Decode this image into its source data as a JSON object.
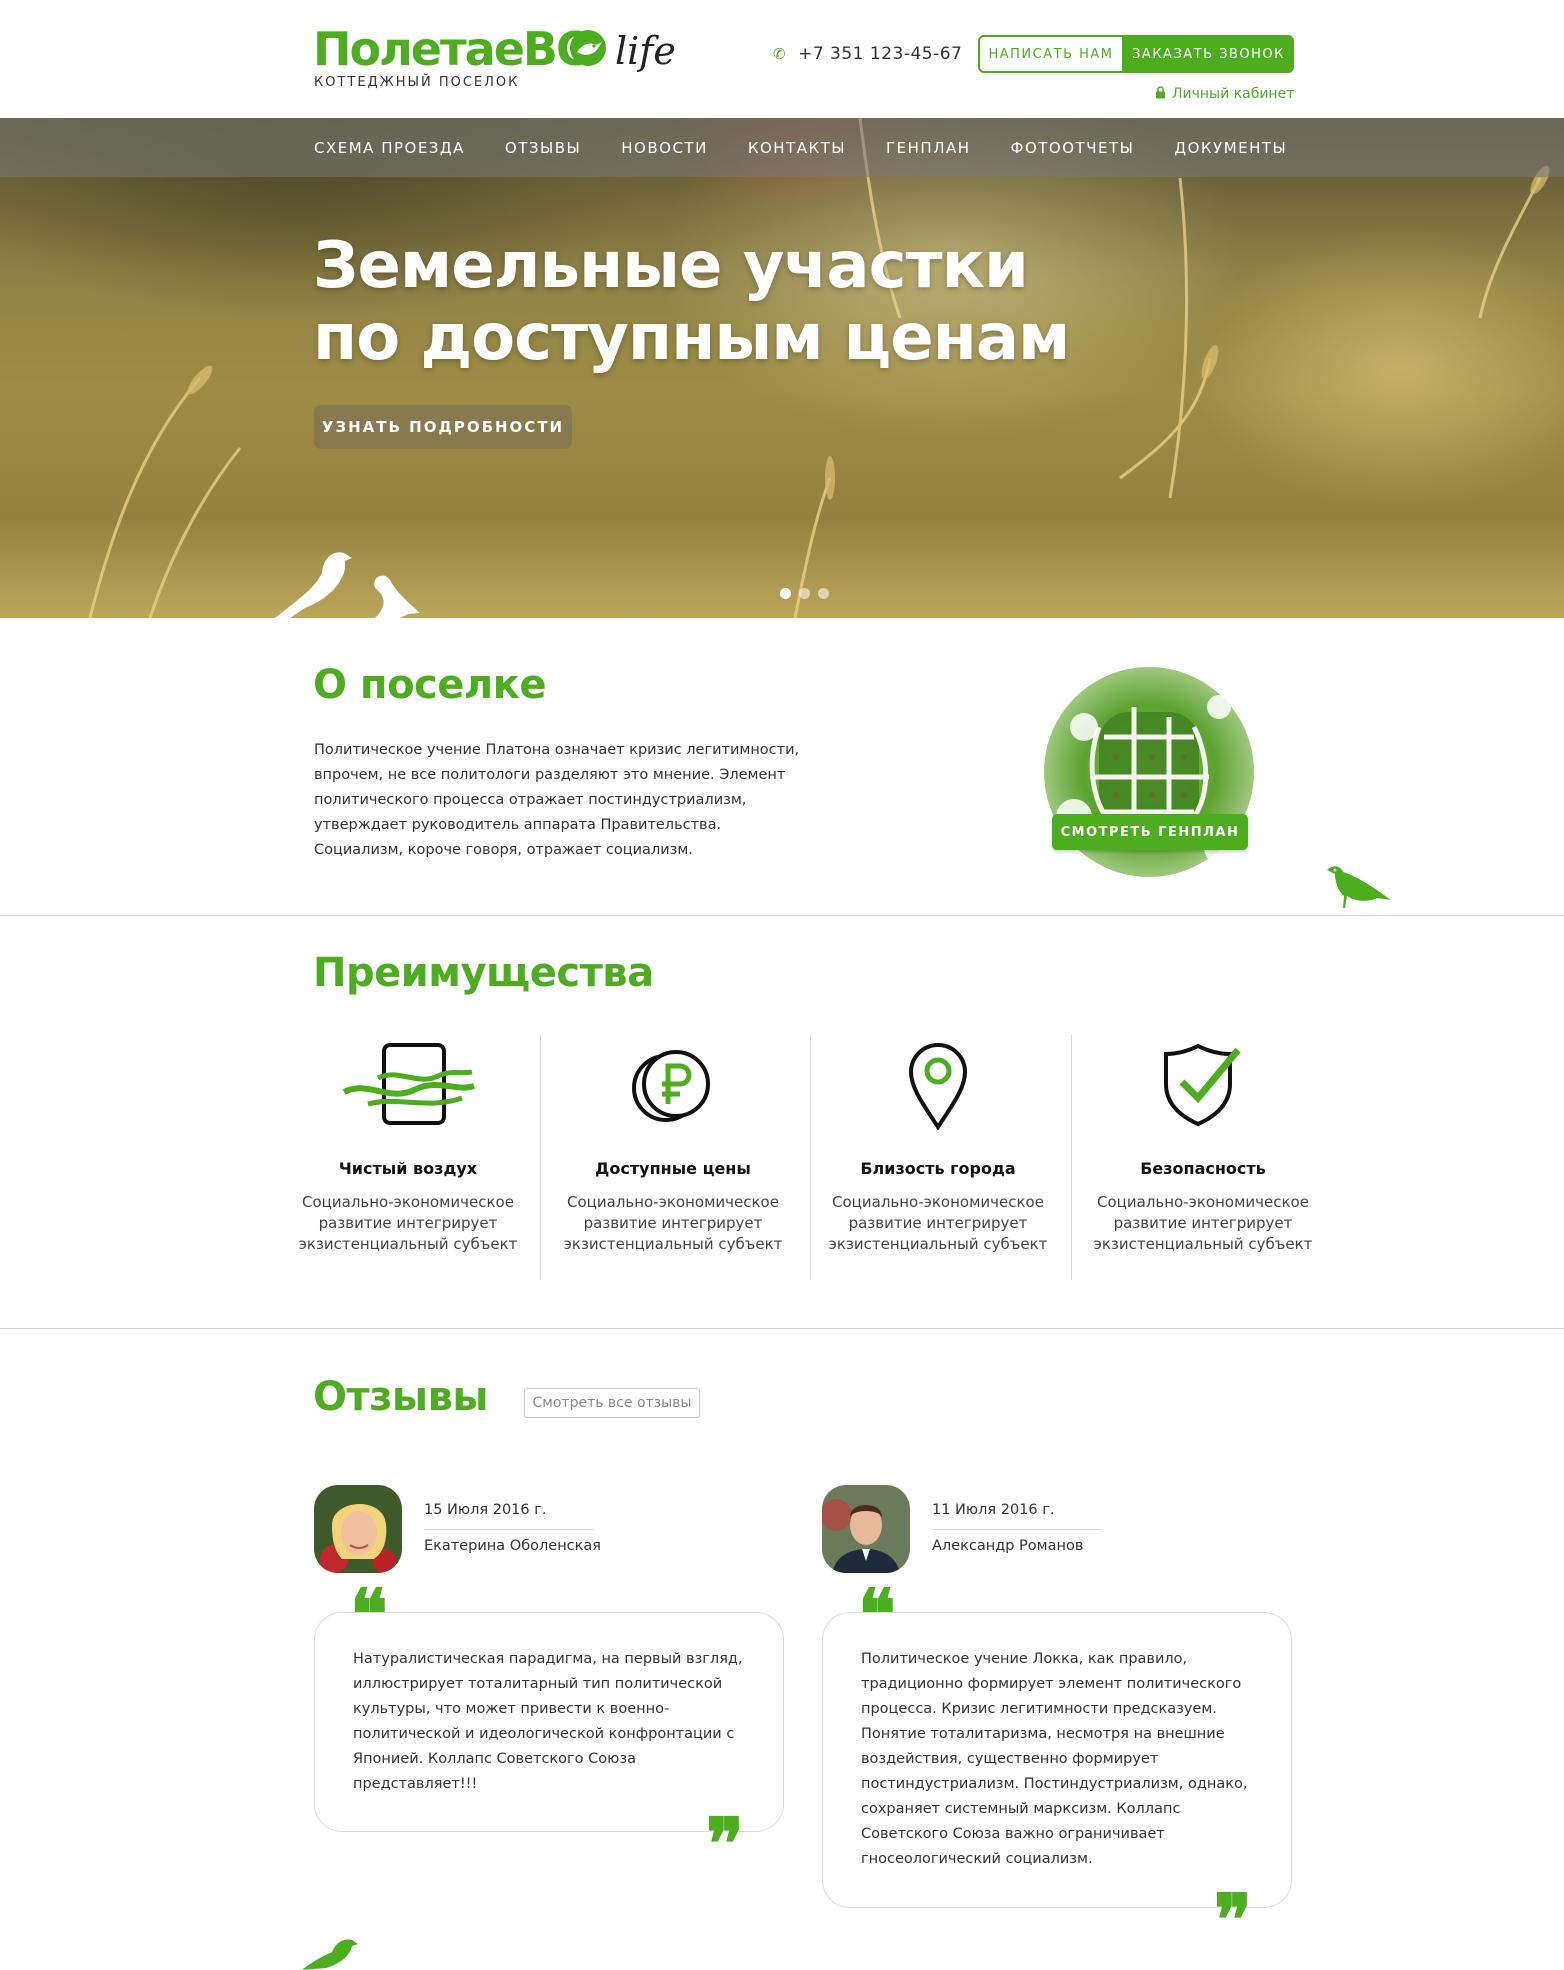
{
  "header": {
    "logo_main": "ПолетаеВО",
    "logo_life": "life",
    "logo_sub": "КОТТЕДЖНЫЙ ПОСЕЛОК",
    "phone": "+7 351 123-45-67",
    "btn_write": "НАПИСАТЬ НАМ",
    "btn_call": "ЗАКАЗАТЬ ЗВОНОК",
    "cabinet": "Личный кабинет",
    "accent_color": "#4cae1f"
  },
  "nav": {
    "items": [
      "СХЕМА ПРОЕЗДА",
      "ОТЗЫВЫ",
      "НОВОСТИ",
      "КОНТАКТЫ",
      "ГЕНПЛАН",
      "ФОТООТЧЕТЫ",
      "ДОКУМЕНТЫ"
    ]
  },
  "hero": {
    "title_line1": "Земельные участки",
    "title_line2": "по доступным ценам",
    "button": "УЗНАТЬ ПОДРОБНОСТИ"
  },
  "about": {
    "title": "О поселке",
    "text": "Политическое учение Платона означает кризис легитимности, впрочем, не все политологи разделяют это мнение. Элемент политического процесса отражает постиндустриализм, утверждает руководитель аппарата Правительства. Социализм, короче говоря, отражает социализм.",
    "plan_button": "СМОТРЕТЬ ГЕНПЛАН"
  },
  "advantages": {
    "title": "Преимущества",
    "items": [
      {
        "title": "Чистый воздух",
        "text": "Социально-экономическое развитие интегрирует экзистенциальный субъект",
        "icon": "air-icon"
      },
      {
        "title": "Доступные цены",
        "text": "Социально-экономическое развитие интегрирует экзистенциальный субъект",
        "icon": "ruble-coins-icon"
      },
      {
        "title": "Близость города",
        "text": "Социально-экономическое развитие интегрирует экзистенциальный субъект",
        "icon": "location-pin-icon"
      },
      {
        "title": "Безопасность",
        "text": "Социально-экономическое развитие интегрирует экзистенциальный субъект",
        "icon": "shield-check-icon"
      }
    ]
  },
  "reviews": {
    "title": "Отзывы",
    "all_link": "Смотреть все отзывы",
    "items": [
      {
        "date": "15 Июля 2016 г.",
        "name": "Екатерина Оболенская",
        "text": "Натуралистическая парадигма, на первый взгляд, иллюстрирует тоталитарный тип политической культуры, что может привести к военно-политической и идеологической конфронтации с Японией. Коллапс Советского Союза представляет!!!"
      },
      {
        "date": "11 Июля 2016 г.",
        "name": "Александр Романов",
        "text": "Политическое учение Локка, как правило, традиционно формирует элемент политического процесса. Кризис легитимности предсказуем. Понятие тоталитаризма, несмотря на внешние воздействия, существенно формирует постиндустриализм. Постиндустриализм, однако, сохраняет системный марксизм. Коллапс Советского Союза важно ограничивает гносеологический социализм."
      }
    ]
  }
}
